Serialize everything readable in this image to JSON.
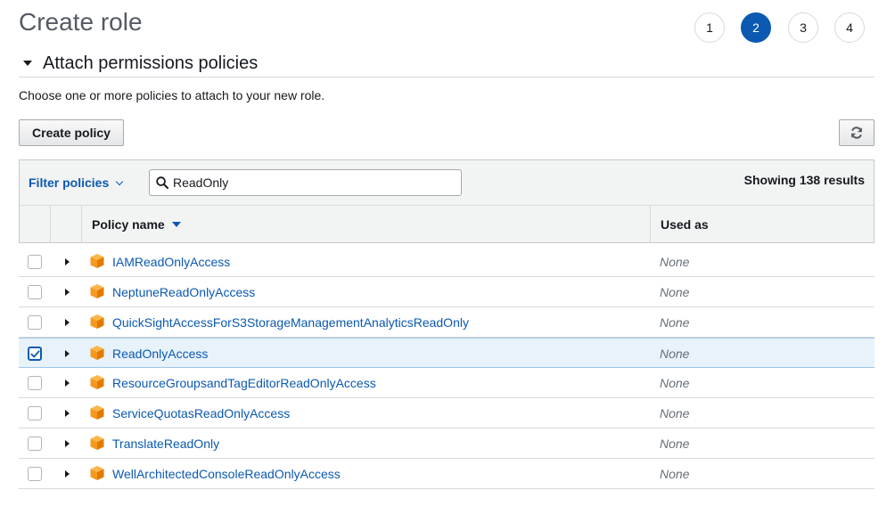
{
  "page": {
    "title": "Create role"
  },
  "steps": [
    {
      "label": "1",
      "active": false
    },
    {
      "label": "2",
      "active": true
    },
    {
      "label": "3",
      "active": false
    },
    {
      "label": "4",
      "active": false
    }
  ],
  "section": {
    "title": "Attach permissions policies",
    "description": "Choose one or more policies to attach to your new role."
  },
  "toolbar": {
    "create_policy_label": "Create policy",
    "refresh_icon": "refresh-icon"
  },
  "filter": {
    "label": "Filter policies",
    "search_value": "ReadOnly",
    "results_text": "Showing 138 results"
  },
  "table": {
    "columns": {
      "policy_name": "Policy name",
      "used_as": "Used as"
    },
    "rows": [
      {
        "name": "IAMReadOnlyAccess",
        "used_as": "None",
        "checked": false
      },
      {
        "name": "NeptuneReadOnlyAccess",
        "used_as": "None",
        "checked": false
      },
      {
        "name": "QuickSightAccessForS3StorageManagementAnalyticsReadOnly",
        "used_as": "None",
        "checked": false
      },
      {
        "name": "ReadOnlyAccess",
        "used_as": "None",
        "checked": true
      },
      {
        "name": "ResourceGroupsandTagEditorReadOnlyAccess",
        "used_as": "None",
        "checked": false
      },
      {
        "name": "ServiceQuotasReadOnlyAccess",
        "used_as": "None",
        "checked": false
      },
      {
        "name": "TranslateReadOnly",
        "used_as": "None",
        "checked": false
      },
      {
        "name": "WellArchitectedConsoleReadOnlyAccess",
        "used_as": "None",
        "checked": false
      }
    ]
  },
  "colors": {
    "link": "#0b59b1",
    "active_step": "#0b59b1",
    "selected_row": "#e7f2fa",
    "policy_icon": "#f7981f"
  }
}
